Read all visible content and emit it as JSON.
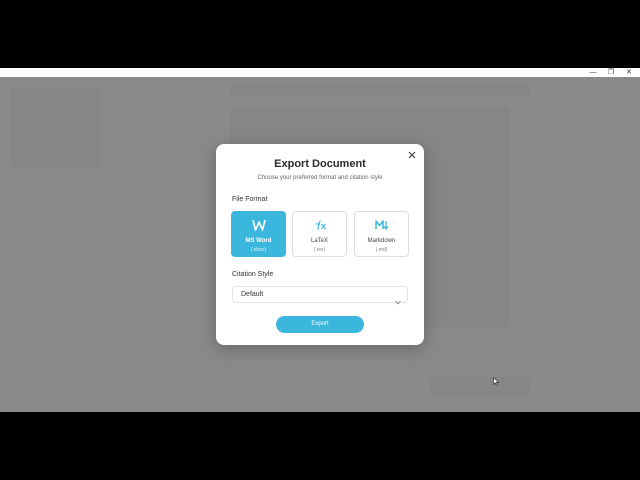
{
  "window": {
    "controls": {
      "minimize": "—",
      "maximize": "❐",
      "close": "✕"
    }
  },
  "modal": {
    "title": "Export Document",
    "subtitle": "Choose your preferred format and citation style",
    "file_format_label": "File Format",
    "formats": [
      {
        "name": "MS Word",
        "ext": "(.docx)",
        "icon": "word-icon",
        "selected": true
      },
      {
        "name": "LaTeX",
        "ext": "(.tex)",
        "icon": "latex-fx-icon",
        "selected": false
      },
      {
        "name": "Markdown",
        "ext": "(.md)",
        "icon": "markdown-icon",
        "selected": false
      }
    ],
    "citation_label": "Citation Style",
    "citation_value": "Default",
    "export_label": "Export",
    "close_icon": "close-icon"
  },
  "colors": {
    "accent": "#3bb6dc",
    "overlay": "#6e6e6e",
    "modal_bg": "#ffffff"
  }
}
